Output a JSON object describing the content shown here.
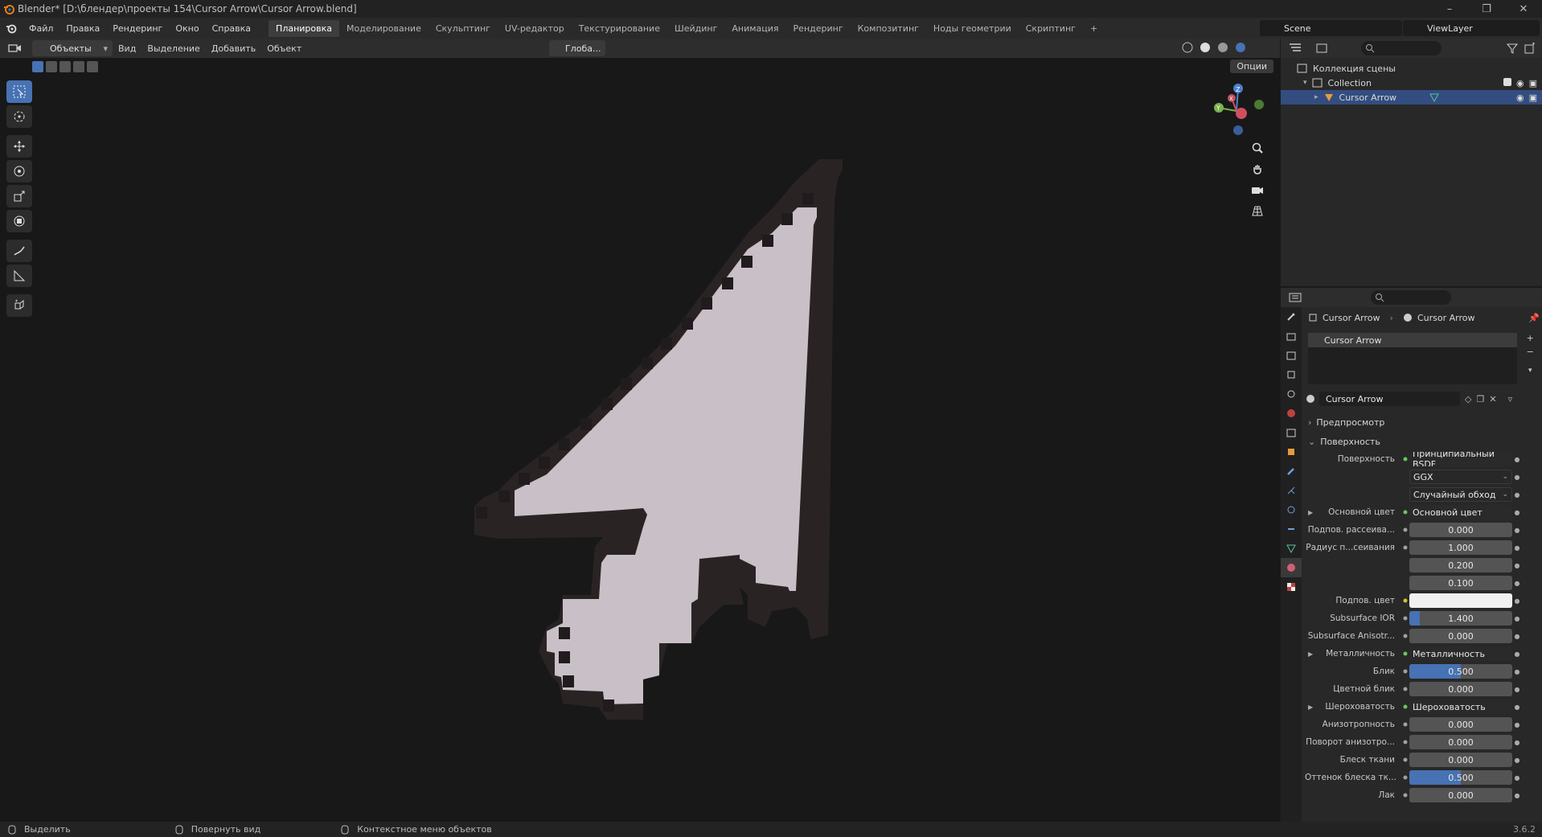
{
  "window": {
    "title": "Blender* [D:\\блендер\\проекты 154\\Cursor Arrow\\Cursor Arrow.blend]"
  },
  "menu": {
    "items": [
      "Файл",
      "Правка",
      "Рендеринг",
      "Окно",
      "Справка"
    ]
  },
  "workspaces": {
    "tabs": [
      "Планировка",
      "Моделирование",
      "Скульптинг",
      "UV-редактор",
      "Текстурирование",
      "Шейдинг",
      "Анимация",
      "Рендеринг",
      "Композитинг",
      "Ноды геометрии",
      "Скриптинг"
    ],
    "add": "+"
  },
  "scene": {
    "name": "Scene"
  },
  "view_layer": {
    "name": "ViewLayer"
  },
  "viewport_header": {
    "mode": "Объекты",
    "menus": [
      "Вид",
      "Выделение",
      "Добавить",
      "Объект"
    ],
    "transform": "Глоба...",
    "options": "Опции"
  },
  "gizmo": {
    "x": "X",
    "y": "Y",
    "z": "Z"
  },
  "statusbar": {
    "select": "Выделить",
    "rotate": "Повернуть вид",
    "context": "Контекстное меню объектов",
    "version": "3.6.2"
  },
  "outliner": {
    "root": "Коллекция сцены",
    "collection": "Collection",
    "object": "Cursor Arrow"
  },
  "properties": {
    "breadcrumb_object": "Cursor Arrow",
    "breadcrumb_material": "Cursor Arrow",
    "slot": "Cursor Arrow",
    "material_name": "Cursor Arrow",
    "preview_panel": "Предпросмотр",
    "surface_panel": "Поверхность",
    "rows": [
      {
        "label": "Поверхность",
        "value": "Принципиальный BSDF",
        "kind": "dark"
      },
      {
        "label": "",
        "value": "GGX",
        "kind": "select"
      },
      {
        "label": "",
        "value": "Случайный обход",
        "kind": "select"
      },
      {
        "label": "Основной цвет",
        "value": "Основной цвет",
        "kind": "dark",
        "expand": true
      },
      {
        "label": "Подпов. рассеива...",
        "value": "0.000",
        "kind": "num",
        "fill": 0
      },
      {
        "label": "Радиус п...сеивания",
        "value": "1.000",
        "kind": "num",
        "fill": 0
      },
      {
        "label": "",
        "value": "0.200",
        "kind": "num",
        "fill": 0,
        "nodot": true
      },
      {
        "label": "",
        "value": "0.100",
        "kind": "num",
        "fill": 0,
        "nodot": true
      },
      {
        "label": "Подпов. цвет",
        "value": "",
        "kind": "color"
      },
      {
        "label": "Subsurface IOR",
        "value": "1.400",
        "kind": "num",
        "fill": 0.1
      },
      {
        "label": "Subsurface Anisotr...",
        "value": "0.000",
        "kind": "num",
        "fill": 0
      },
      {
        "label": "Металличность",
        "value": "Металличность",
        "kind": "dark",
        "expand": true
      },
      {
        "label": "Блик",
        "value": "0.500",
        "kind": "num",
        "fill": 0.5
      },
      {
        "label": "Цветной блик",
        "value": "0.000",
        "kind": "num",
        "fill": 0
      },
      {
        "label": "Шероховатость",
        "value": "Шероховатость",
        "kind": "dark",
        "expand": true
      },
      {
        "label": "Анизотропность",
        "value": "0.000",
        "kind": "num",
        "fill": 0
      },
      {
        "label": "Поворот анизотро...",
        "value": "0.000",
        "kind": "num",
        "fill": 0
      },
      {
        "label": "Блеск ткани",
        "value": "0.000",
        "kind": "num",
        "fill": 0
      },
      {
        "label": "Оттенок блеска тк...",
        "value": "0.500",
        "kind": "num",
        "fill": 0.5
      },
      {
        "label": "Лак",
        "value": "0.000",
        "kind": "num",
        "fill": 0
      }
    ]
  },
  "colors": {
    "accent": "#4772b3",
    "selection": "#334d80",
    "model_face": "#c9bfc6",
    "model_side": "#2a2324"
  }
}
